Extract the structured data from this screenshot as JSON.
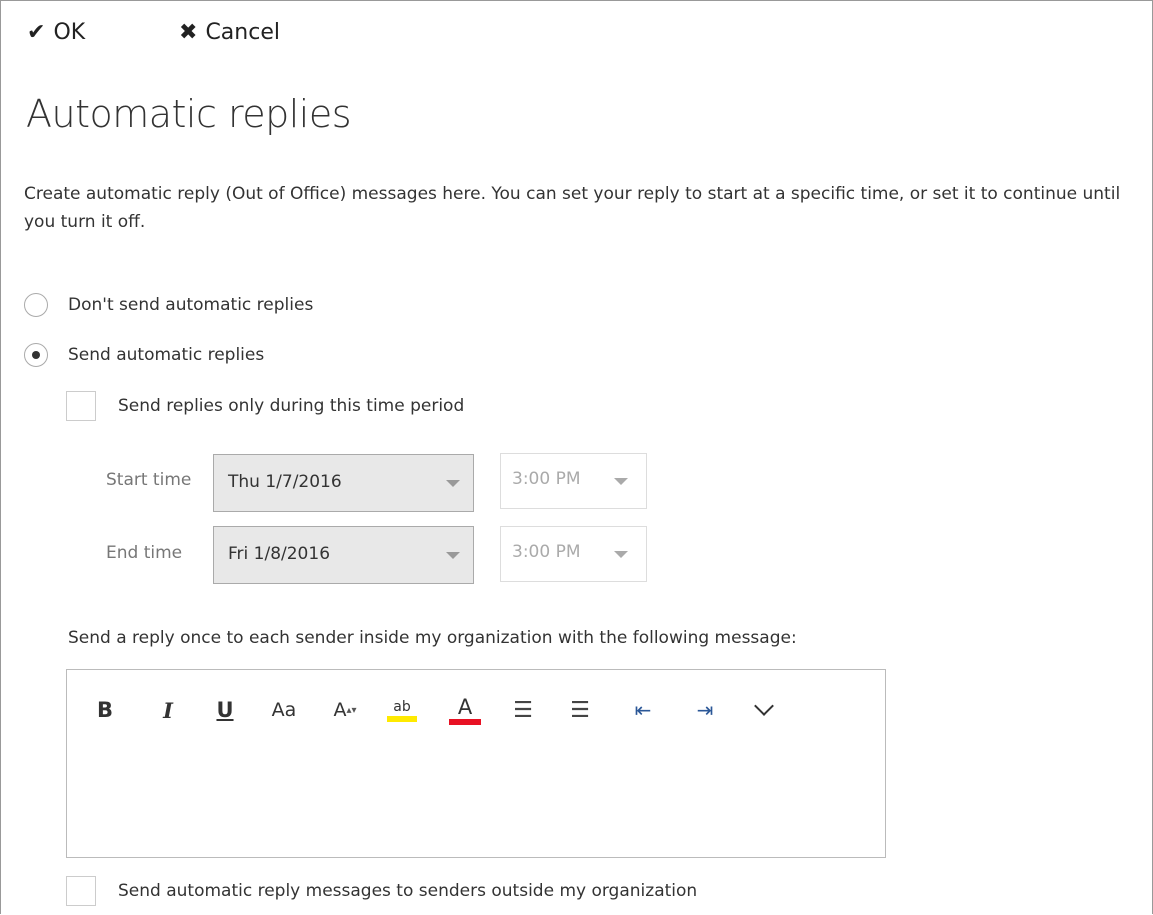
{
  "toolbar": {
    "ok_label": "OK",
    "cancel_label": "Cancel"
  },
  "page": {
    "title": "Automatic replies",
    "description": "Create automatic reply (Out of Office) messages here. You can set your reply to start at a specific time, or set it to continue until you turn it off."
  },
  "options": {
    "dont_send_label": "Don't send automatic replies",
    "send_label": "Send automatic replies",
    "selected": "send",
    "time_period_label": "Send replies only during this time period",
    "time_period_checked": false
  },
  "schedule": {
    "start_label": "Start time",
    "start_date": "Thu 1/7/2016",
    "start_time": "3:00 PM",
    "end_label": "End time",
    "end_date": "Fri 1/8/2016",
    "end_time": "3:00 PM"
  },
  "inside": {
    "label": "Send a reply once to each sender inside my organization with the following message:"
  },
  "format_toolbar": {
    "bold": "B",
    "italic": "I",
    "underline": "U",
    "font": "Aa",
    "size": "A",
    "highlight": "ab",
    "font_color": "A",
    "bullets": "☰",
    "numbering": "☰",
    "outdent": "⇤",
    "indent": "⇥"
  },
  "outside": {
    "label": "Send automatic reply messages to senders outside my organization",
    "checked": false
  },
  "colors": {
    "highlight": "#ffea00",
    "font_color": "#e81123",
    "indent_blue": "#2b5797"
  }
}
